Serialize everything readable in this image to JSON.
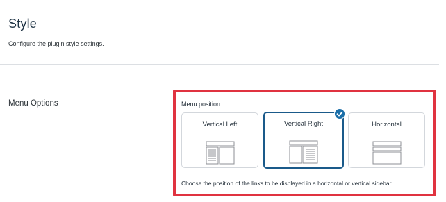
{
  "header": {
    "title": "Style",
    "subtitle": "Configure the plugin style settings."
  },
  "menu_options": {
    "section_label": "Menu Options",
    "field_label": "Menu position",
    "options": [
      {
        "label": "Vertical Left",
        "icon": "layout-vertical-left-icon",
        "selected": false
      },
      {
        "label": "Vertical Right",
        "icon": "layout-vertical-right-icon",
        "selected": true
      },
      {
        "label": "Horizontal",
        "icon": "layout-horizontal-icon",
        "selected": false
      }
    ],
    "help_text": "Choose the position of the links to be displayed in a horizontal or vertical sidebar."
  },
  "colors": {
    "selected_border": "#1a5a8a",
    "check_badge": "#1a6ea8",
    "highlight_border": "#e03340",
    "divider": "#dcdfe3"
  }
}
